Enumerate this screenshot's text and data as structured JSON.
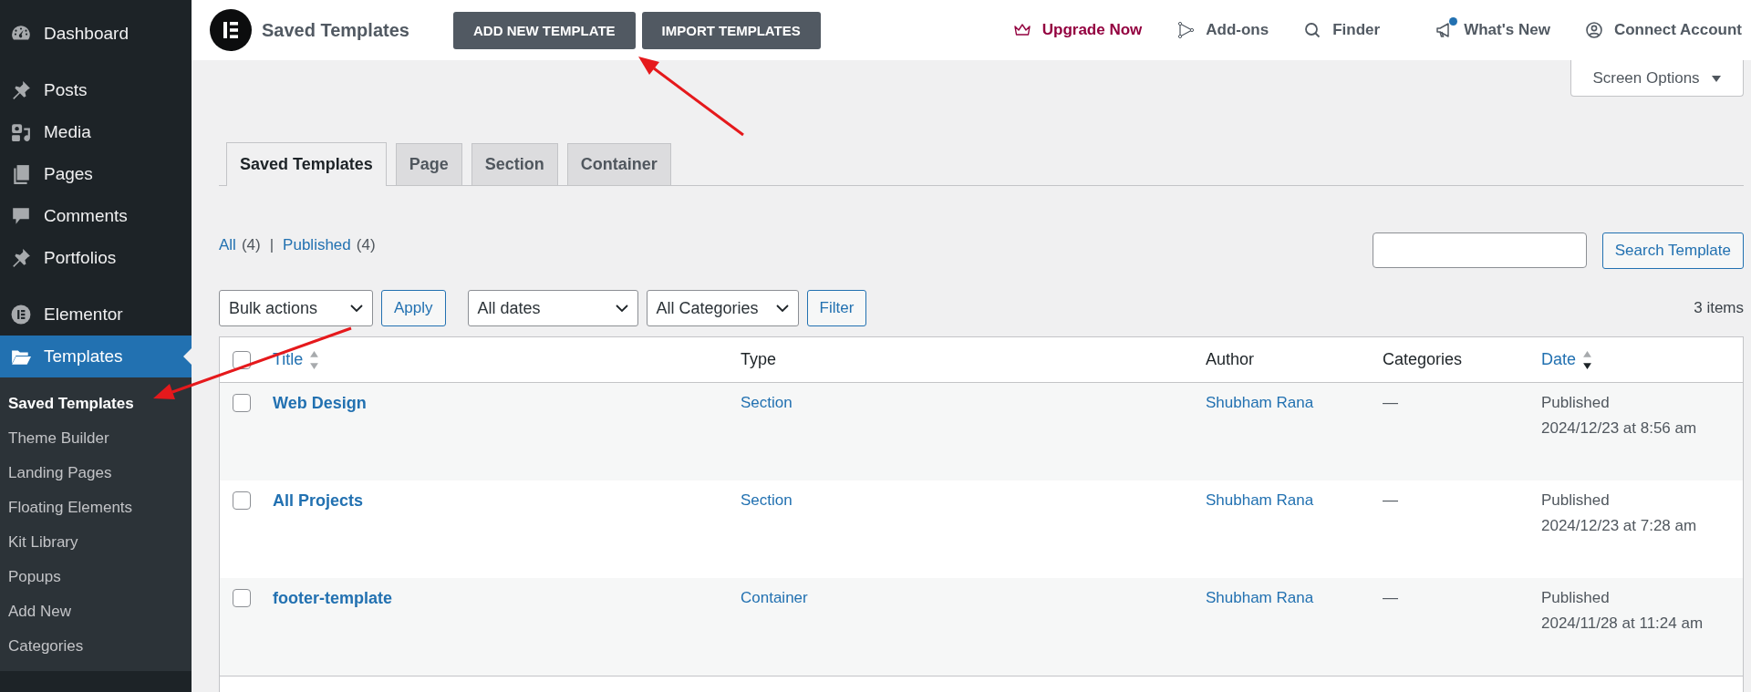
{
  "sidebar": {
    "groups": [
      {
        "items": [
          {
            "label": "Dashboard",
            "selected": false
          }
        ]
      },
      {
        "items": [
          {
            "label": "Posts",
            "selected": false
          },
          {
            "label": "Media",
            "selected": false
          },
          {
            "label": "Pages",
            "selected": false
          },
          {
            "label": "Comments",
            "selected": false
          },
          {
            "label": "Portfolios",
            "selected": false
          }
        ]
      },
      {
        "items": [
          {
            "label": "Elementor",
            "selected": false
          },
          {
            "label": "Templates",
            "selected": true,
            "children": [
              {
                "label": "Saved Templates",
                "selected": true
              },
              {
                "label": "Theme Builder",
                "selected": false
              },
              {
                "label": "Landing Pages",
                "selected": false
              },
              {
                "label": "Floating Elements",
                "selected": false
              },
              {
                "label": "Kit Library",
                "selected": false
              },
              {
                "label": "Popups",
                "selected": false
              },
              {
                "label": "Add New",
                "selected": false
              },
              {
                "label": "Categories",
                "selected": false
              }
            ]
          }
        ]
      }
    ]
  },
  "topbar": {
    "title": "Saved Templates",
    "buttons": [
      "ADD NEW TEMPLATE",
      "IMPORT TEMPLATES"
    ],
    "links": [
      {
        "label": "Upgrade Now",
        "kind": "upgrade",
        "notification": false
      },
      {
        "label": "Add-ons",
        "kind": "link",
        "notification": false
      },
      {
        "label": "Finder",
        "kind": "link",
        "notification": false
      },
      {
        "label": "What's New",
        "kind": "link",
        "notification": true
      },
      {
        "label": "Connect Account",
        "kind": "link",
        "notification": false
      }
    ]
  },
  "screen_options": "Screen Options",
  "tabs": [
    {
      "label": "Saved Templates",
      "selected": true
    },
    {
      "label": "Page",
      "selected": false
    },
    {
      "label": "Section",
      "selected": false
    },
    {
      "label": "Container",
      "selected": false
    }
  ],
  "views": [
    {
      "label": "All",
      "count": "(4)"
    },
    {
      "label": "Published",
      "count": "(4)"
    }
  ],
  "views_separator": "|",
  "search": {
    "button": "Search Template"
  },
  "bulk_actions": {
    "value": "Bulk actions",
    "button": "Apply"
  },
  "filters": {
    "selects": [
      "All dates",
      "All Categories"
    ],
    "button": "Filter"
  },
  "items_count": "3 items",
  "table": {
    "select_all": {
      "checked": false
    },
    "columns": [
      {
        "label": "Title",
        "sortable": true,
        "sorted": false
      },
      {
        "label": "Type",
        "sortable": false,
        "sorted": false
      },
      {
        "label": "Author",
        "sortable": false,
        "sorted": false
      },
      {
        "label": "Categories",
        "sortable": false,
        "sorted": false
      },
      {
        "label": "Date",
        "sortable": true,
        "sorted": true
      }
    ],
    "rows": [
      {
        "checked": false,
        "title": "Web Design",
        "type": "Section",
        "author": "Shubham Rana",
        "categories": "—",
        "status": "Published",
        "date": "2024/12/23 at 8:56 am"
      },
      {
        "checked": false,
        "title": "All Projects",
        "type": "Section",
        "author": "Shubham Rana",
        "categories": "—",
        "status": "Published",
        "date": "2024/12/23 at 7:28 am"
      },
      {
        "checked": false,
        "title": "footer-template",
        "type": "Container",
        "author": "Shubham Rana",
        "categories": "—",
        "status": "Published",
        "date": "2024/11/28 at 11:24 am"
      }
    ]
  }
}
